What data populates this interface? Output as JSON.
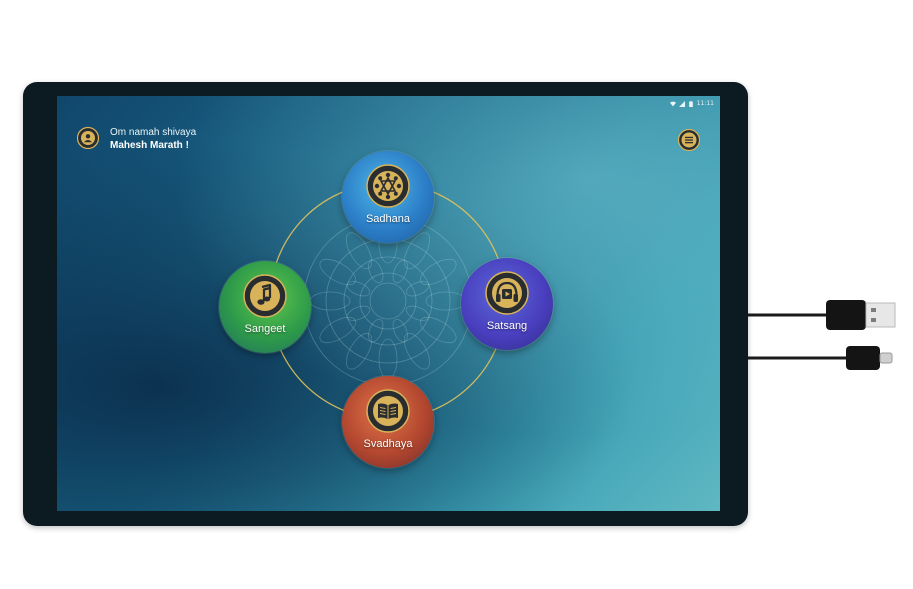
{
  "status_bar": {
    "time": "11:11"
  },
  "header": {
    "greeting": "Om namah shivaya",
    "user_name": "Mahesh Marath !"
  },
  "icons": {
    "avatar": "user-avatar-icon",
    "menu": "hamburger-menu-icon",
    "sadhana": "chakra-emblem-icon",
    "sangeet": "music-note-icon",
    "satsang": "headphones-play-icon",
    "svadhaya": "open-book-icon"
  },
  "nav": {
    "sadhana": {
      "label": "Sadhana"
    },
    "sangeet": {
      "label": "Sangeet"
    },
    "satsang": {
      "label": "Satsang"
    },
    "svadhaya": {
      "label": "Svadhaya"
    }
  },
  "colors": {
    "ring": "#e2c35a",
    "emblem_gold": "#d8b35a",
    "sadhana": "#2c7fc8",
    "sangeet": "#2d9a4a",
    "satsang": "#4a3fbf",
    "svadhaya": "#b3472f"
  }
}
